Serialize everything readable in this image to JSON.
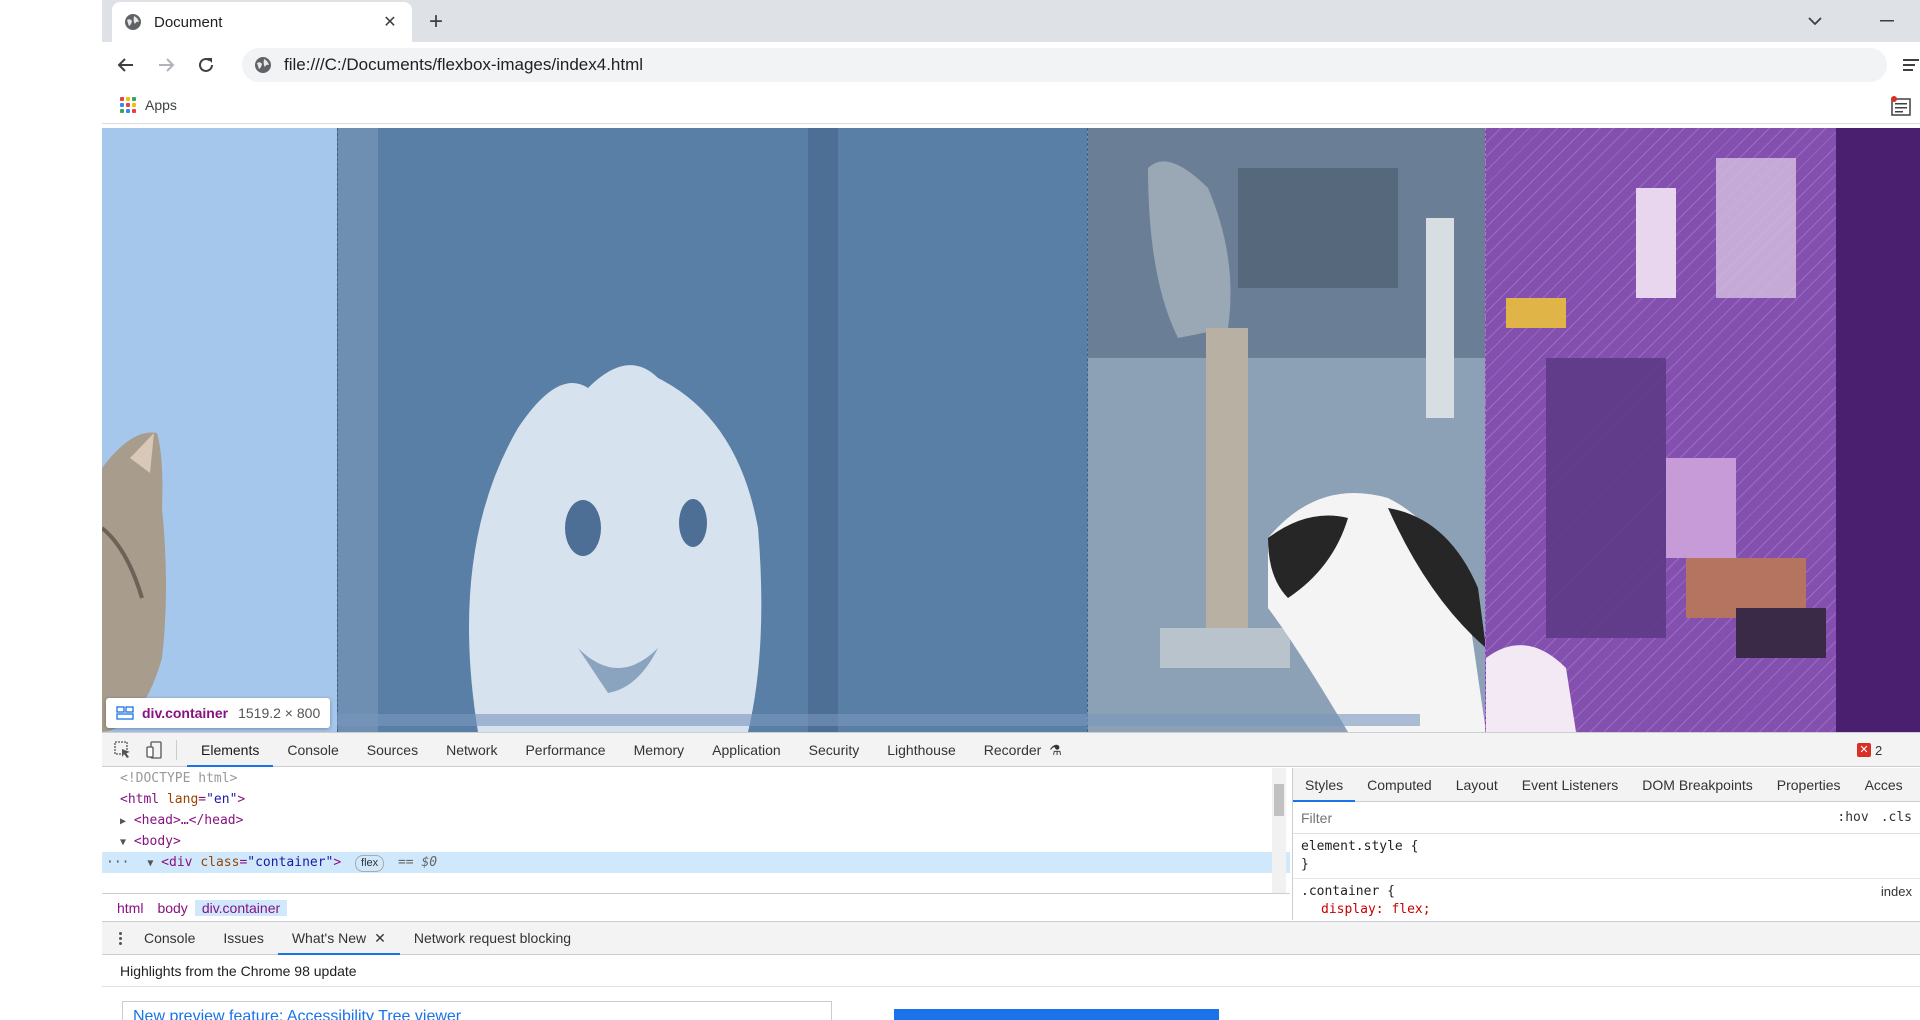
{
  "tab": {
    "title": "Document",
    "close_glyph": "✕"
  },
  "toolbar": {
    "url": "file:///C:/Documents/flexbox-images/index4.html"
  },
  "bookmarks": {
    "apps_label": "Apps"
  },
  "inspect_tooltip": {
    "element": "div.container",
    "size": "1519.2 × 800"
  },
  "devtools": {
    "tabs": [
      "Elements",
      "Console",
      "Sources",
      "Network",
      "Performance",
      "Memory",
      "Application",
      "Security",
      "Lighthouse",
      "Recorder"
    ],
    "active_tab": "Elements",
    "error_count": "2",
    "dom": {
      "doctype": "<!DOCTYPE html>",
      "html_open": "<html",
      "lang_attr": "lang",
      "lang_val": "\"en\"",
      "html_close": ">",
      "head": "<head>…</head>",
      "body": "<body>",
      "div_open": "<div",
      "class_attr": "class",
      "class_val": "\"container\"",
      "div_close": ">",
      "flex_badge": "flex",
      "eq_ref": "== $0"
    },
    "breadcrumbs": [
      "html",
      "body",
      "div.container"
    ],
    "styles_tabs": [
      "Styles",
      "Computed",
      "Layout",
      "Event Listeners",
      "DOM Breakpoints",
      "Properties",
      "Acces"
    ],
    "filter_placeholder": "Filter",
    "hov_label": ":hov",
    "cls_label": ".cls",
    "rules": {
      "element_style": "element.style {",
      "element_style_close": "}",
      "container_selector": ".container {",
      "container_src": "index",
      "display_prop": "display: flex;"
    },
    "drawer_tabs": [
      "Console",
      "Issues",
      "What's New",
      "Network request blocking"
    ],
    "drawer_active": "What's New",
    "whatsnew_heading": "Highlights from the Chrome 98 update",
    "whatsnew_card_link": "New preview feature: Accessibility Tree viewer"
  },
  "colors": {
    "overlay_content": "#a6c7ec",
    "overlay_margin": "#7a3fa8",
    "accent": "#1a73e8"
  }
}
